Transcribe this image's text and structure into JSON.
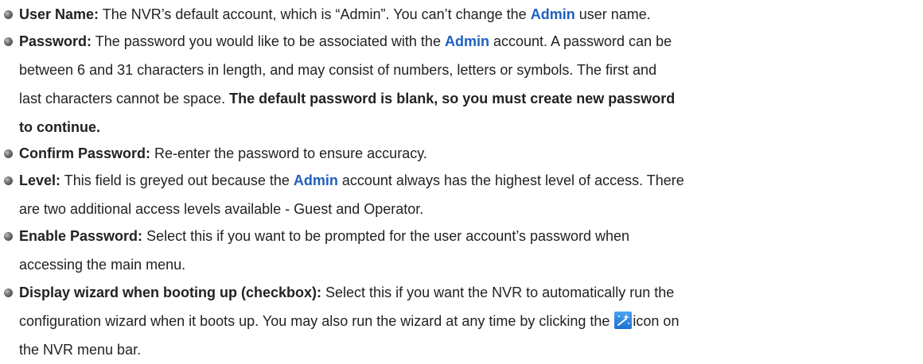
{
  "colors": {
    "accent": "#1f5fbf",
    "text": "#222222"
  },
  "icons": {
    "bullet": "round-bullet-icon",
    "wizard": "magic-wand-icon"
  },
  "items": [
    {
      "term": "User Name:",
      "t1": " The NVR’s default account, which is  “Admin”. You can’t change the ",
      "admin": "Admin",
      "t2": " user name."
    },
    {
      "term": "Password:",
      "t1": " The password you would like to be associated with the ",
      "admin": "Admin",
      "t2": " account. A password can be",
      "line2": "between 6 and 31 characters in length, and may consist of numbers, letters or symbols. The first and",
      "line3a": "last characters cannot be space.  ",
      "line3b": "The  default password is blank, so you must create new password",
      "line4": "to continue."
    },
    {
      "term": "Confirm Password:",
      "t1": " Re-enter the password to ensure accuracy."
    },
    {
      "term": "Level:",
      "t1": " This field is greyed out because the ",
      "admin": "Admin",
      "t2": " account always has the highest level of access. There",
      "line2": "are two additional access levels available - Guest and Operator."
    },
    {
      "term": "Enable Password:",
      "t1": " Select this if you want to be prompted for the user account’s password when",
      "line2": "accessing the main menu."
    },
    {
      "term": "Display wizard when booting up (checkbox):",
      "t1": " Select this if you want the NVR to automatically run the",
      "line2a": "configuration wizard when it boots up. You may also run the wizard at any time by clicking the ",
      "line2b": "icon on",
      "line3": "the NVR menu bar."
    }
  ]
}
